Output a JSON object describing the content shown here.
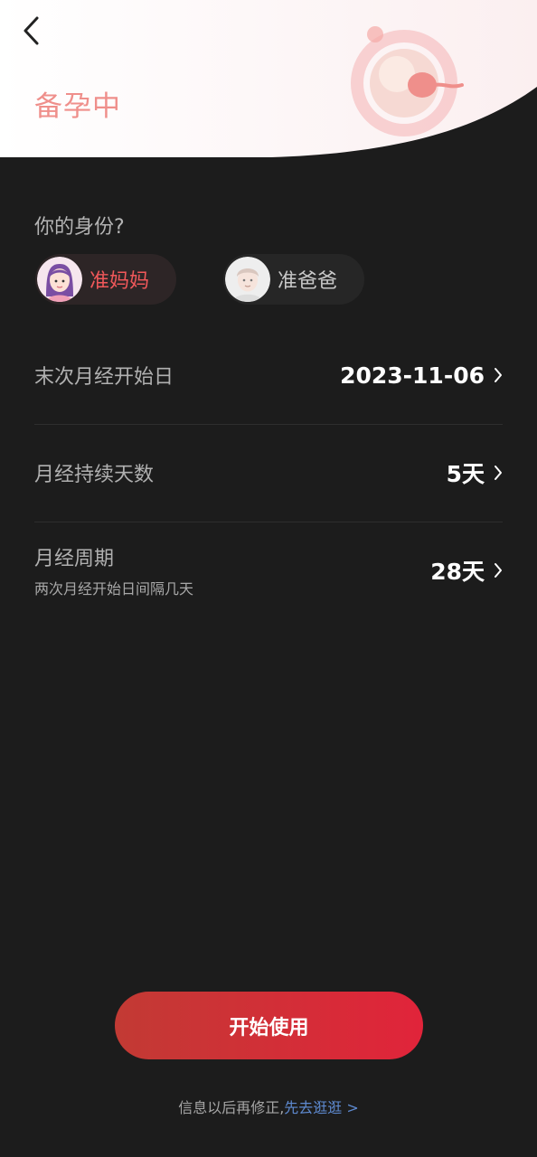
{
  "header": {
    "title": "备孕中"
  },
  "identity": {
    "question": "你的身份?",
    "options": [
      {
        "label": "准妈妈",
        "selected": true
      },
      {
        "label": "准爸爸",
        "selected": false
      }
    ]
  },
  "fields": [
    {
      "label": "末次月经开始日",
      "value": "2023-11-06"
    },
    {
      "label": "月经持续天数",
      "value": "5天"
    },
    {
      "label": "月经周期",
      "sublabel": "两次月经开始日间隔几天",
      "value": "28天"
    }
  ],
  "actions": {
    "start_label": "开始使用"
  },
  "footer": {
    "note": "信息以后再修正,",
    "link": "先去逛逛 >"
  },
  "colors": {
    "background": "#1c1c1c",
    "accent": "#e1243a",
    "title": "#ef8f8b",
    "link": "#5e8ad0"
  }
}
